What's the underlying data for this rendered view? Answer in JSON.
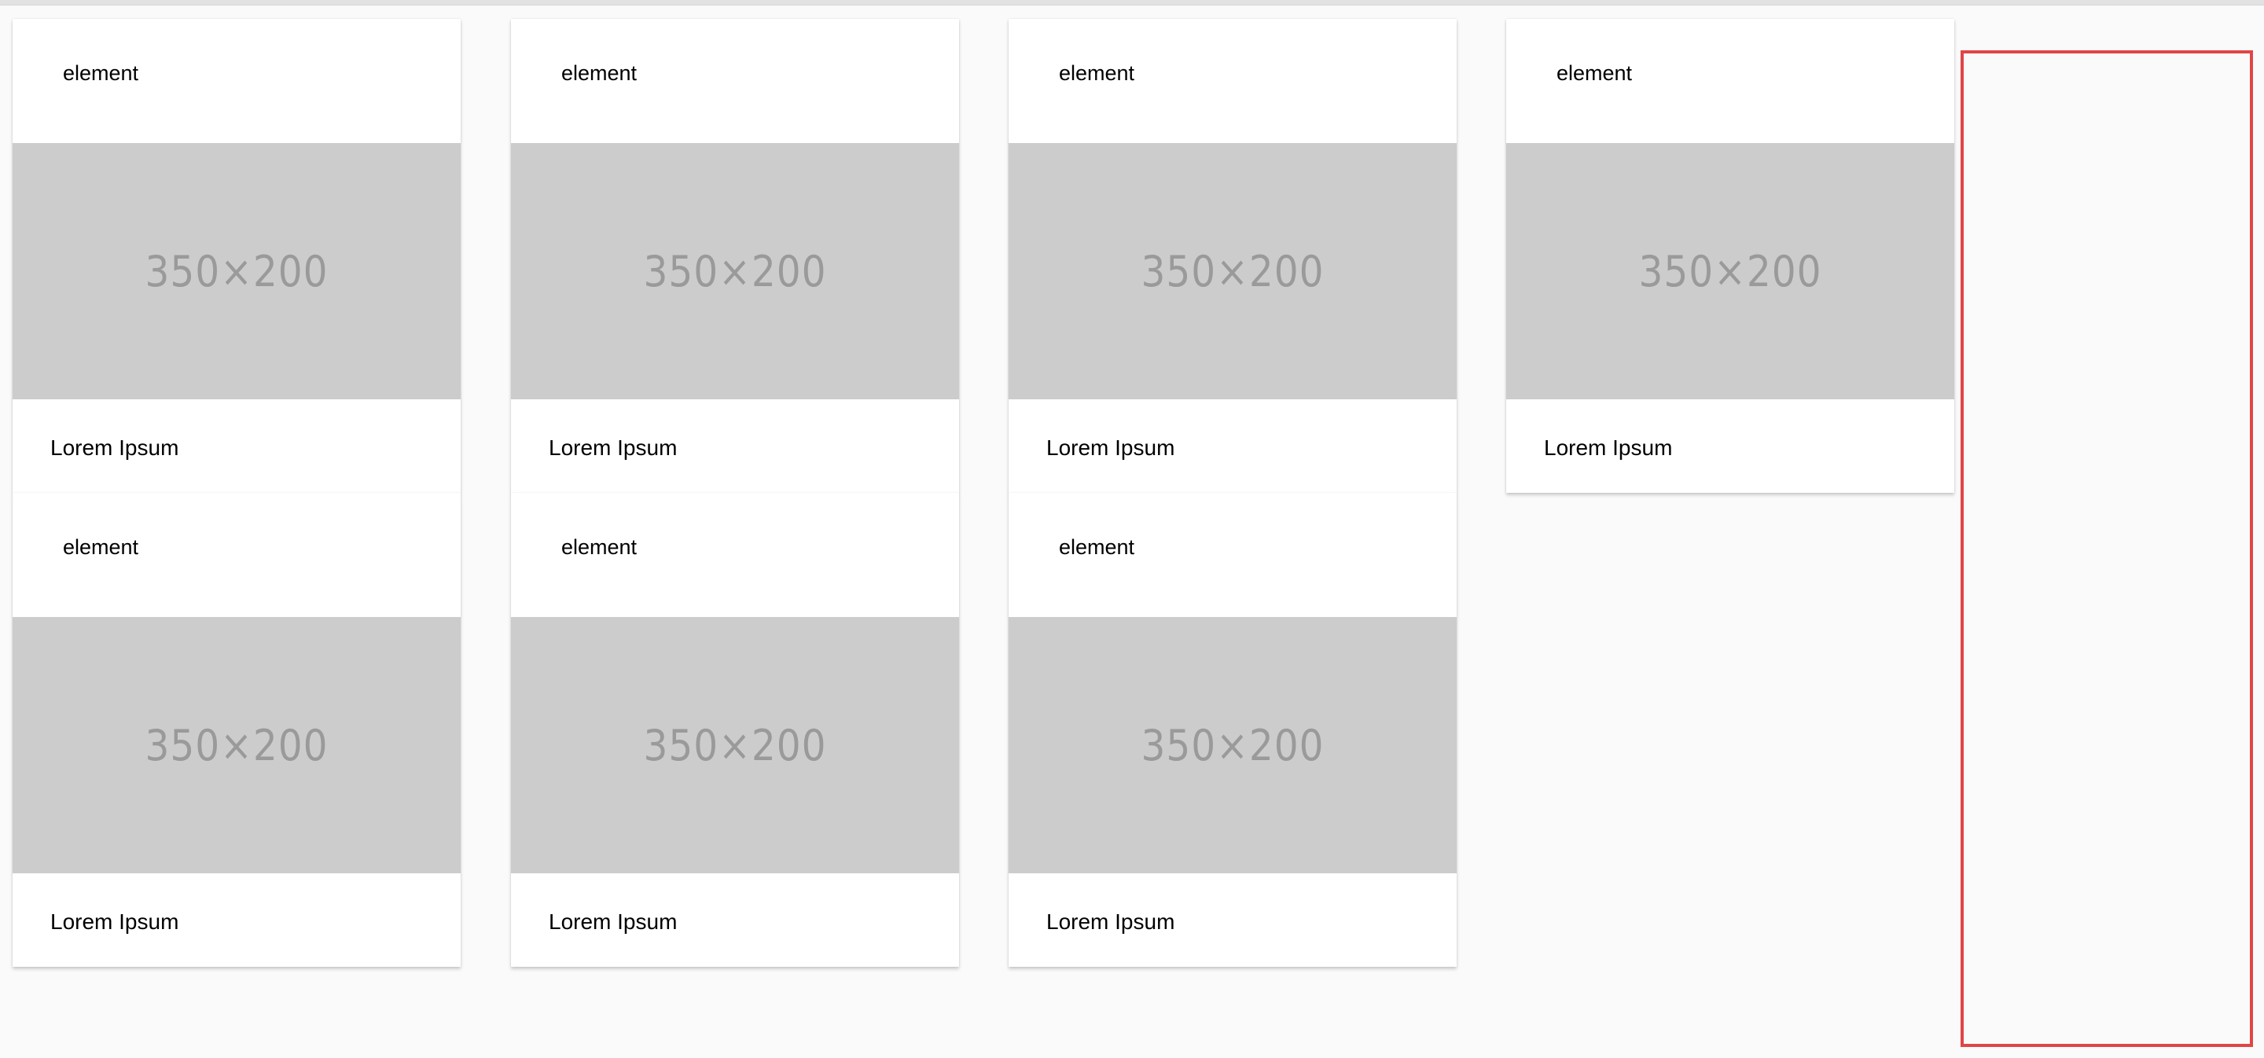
{
  "cards": [
    {
      "header": "element",
      "image_text": "350×200",
      "footer": "Lorem Ipsum"
    },
    {
      "header": "element",
      "image_text": "350×200",
      "footer": "Lorem Ipsum"
    },
    {
      "header": "element",
      "image_text": "350×200",
      "footer": "Lorem Ipsum"
    },
    {
      "header": "element",
      "image_text": "350×200",
      "footer": "Lorem Ipsum"
    },
    {
      "header": "element",
      "image_text": "350×200",
      "footer": "Lorem Ipsum"
    },
    {
      "header": "element",
      "image_text": "350×200",
      "footer": "Lorem Ipsum"
    },
    {
      "header": "element",
      "image_text": "350×200",
      "footer": "Lorem Ipsum"
    }
  ],
  "colors": {
    "background": "#fafafa",
    "card": "#ffffff",
    "placeholder": "#cccccc",
    "placeholder_text": "#9a9a9a",
    "highlight_outline": "#e04646"
  }
}
